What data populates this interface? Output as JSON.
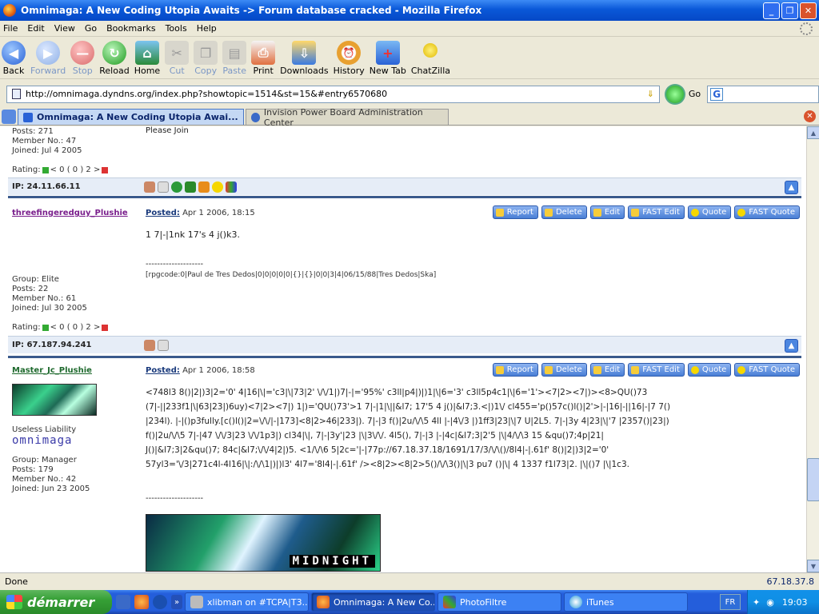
{
  "window": {
    "title": "Omnimaga: A New Coding Utopia Awaits -> Forum database cracked - Mozilla Firefox",
    "min_label": "_",
    "max_label": "❐",
    "close_label": "✕"
  },
  "menu": [
    "File",
    "Edit",
    "View",
    "Go",
    "Bookmarks",
    "Tools",
    "Help"
  ],
  "toolbar": {
    "back": "Back",
    "forward": "Forward",
    "stop": "Stop",
    "reload": "Reload",
    "home": "Home",
    "cut": "Cut",
    "copy": "Copy",
    "paste": "Paste",
    "print": "Print",
    "downloads": "Downloads",
    "history": "History",
    "new_tab": "New Tab",
    "chatzilla": "ChatZilla"
  },
  "address": {
    "url": "http://omnimaga.dyndns.org/index.php?showtopic=1514&st=15&#entry6570680",
    "go": "Go",
    "search_value": ""
  },
  "tabs": [
    {
      "label": "Omnimaga: A New Coding Utopia Awai..."
    },
    {
      "label": "Invision Power Board Administration Center"
    }
  ],
  "posts": {
    "first": {
      "posts": "Posts: 271",
      "member_no": "Member No.: 47",
      "joined": "Joined: Jul 4 2005",
      "body": "Please Join",
      "rating": "Rating:",
      "rating_vals": "< 0 ( 0 ) 2 >",
      "ip": "IP: 24.11.66.11"
    },
    "second": {
      "username": "threefingeredguy_Plushie",
      "posted_label": "Posted:",
      "posted_date": "Apr 1 2006, 18:15",
      "body": "1 7|-|1nk 17's 4 j()k3.",
      "dashes": "--------------------",
      "sig": "[rpgcode:0|Paul de Tres Dedos|0|0|0|0|0|{}|{}|0|0|3|4|06/15/88|Tres Dedos|Ska]",
      "group": "Group: Elite",
      "posts": "Posts: 22",
      "member_no": "Member No.: 61",
      "joined": "Joined: Jul 30 2005",
      "rating": "Rating:",
      "rating_vals": "< 0 ( 0 ) 2 >",
      "ip": "IP: 67.187.94.241"
    },
    "third": {
      "username": "Master_Jc_Plushie",
      "posted_label": "Posted:",
      "posted_date": "Apr 1 2006, 18:58",
      "title": "Useless Liability",
      "logo_text": "omnimaga",
      "group": "Group: Manager",
      "posts": "Posts: 179",
      "member_no": "Member No.: 42",
      "joined": "Joined: Jun 23 2005",
      "body_lines": [
        "<748l3 8()|2|)3|2='0' 4|16|\\|='c3|\\|73|2' \\/\\/1|)7|-|='95%' c3ll|p4|)|)1|\\|6='3' c3ll5p4c1|\\|6='1'><7|2><7|)><8>QU()73",
        "(7|-||233f1|\\|63|23|)6uy)<7|2><7|) 1|)='QU()73'>1 7|-|1|\\||&l7; 17'5 4 j()|&l7;3.<|)1\\/ cl455='p()57c()l()|2'>|-|16|-||16|-|7 7()",
        "|234l). |-|()p3fully.[c()l()|2=\\/\\/|-|173]<8|2>46|233|). 7|-|3 f()|2u/\\/\\5 4ll |-|4\\/3 |)1ff3|23|\\|7 U|2L5. 7|-|3y 4|23|\\|'7 |2357()|23|)",
        "f()|2u/\\/\\5 7|-|47 \\/\\/3|23 \\/\\/1p3|) cl34|\\|, 7|-|3y'|23 |\\|3\\/\\/. 4l5(), 7|-|3 |-|4c|&l7;3|2'5 |\\|4/\\/\\3 15 &qu()7;4p|21|",
        "J()|&l7;3|2&qu()7; 84c|&l7;\\/\\/4|2|)5. <1/\\/\\6 5|2c='|-|77p://67.18.37.18/1691/17/3/\\/\\()/8l4|-|.61f' 8()|2|)3|2='0'",
        "57yl3='\\/3|271c4l-4l16|\\|:/\\/\\1|)|)l3' 4l7='8l4|-|.61f' /><8|2><8|2>5()/\\/\\3()|\\|3 pu7 ()|\\| 4 1337 f1l73|2. |\\|()7 |\\|1c3."
      ],
      "dashes": "--------------------",
      "sig_img_text": "MIDNIGHT"
    },
    "actions": [
      "Report",
      "Delete",
      "Edit",
      "FAST Edit",
      "Quote",
      "FAST Quote"
    ]
  },
  "status": {
    "left": "Done",
    "right": "67.18.37.8"
  },
  "taskbar": {
    "start": "démarrer",
    "tasks": [
      "xlibman on #TCPA|T3...",
      "Omnimaga: A New Co...",
      "PhotoFiltre",
      "iTunes"
    ],
    "lang": "FR",
    "clock": "19:03"
  }
}
